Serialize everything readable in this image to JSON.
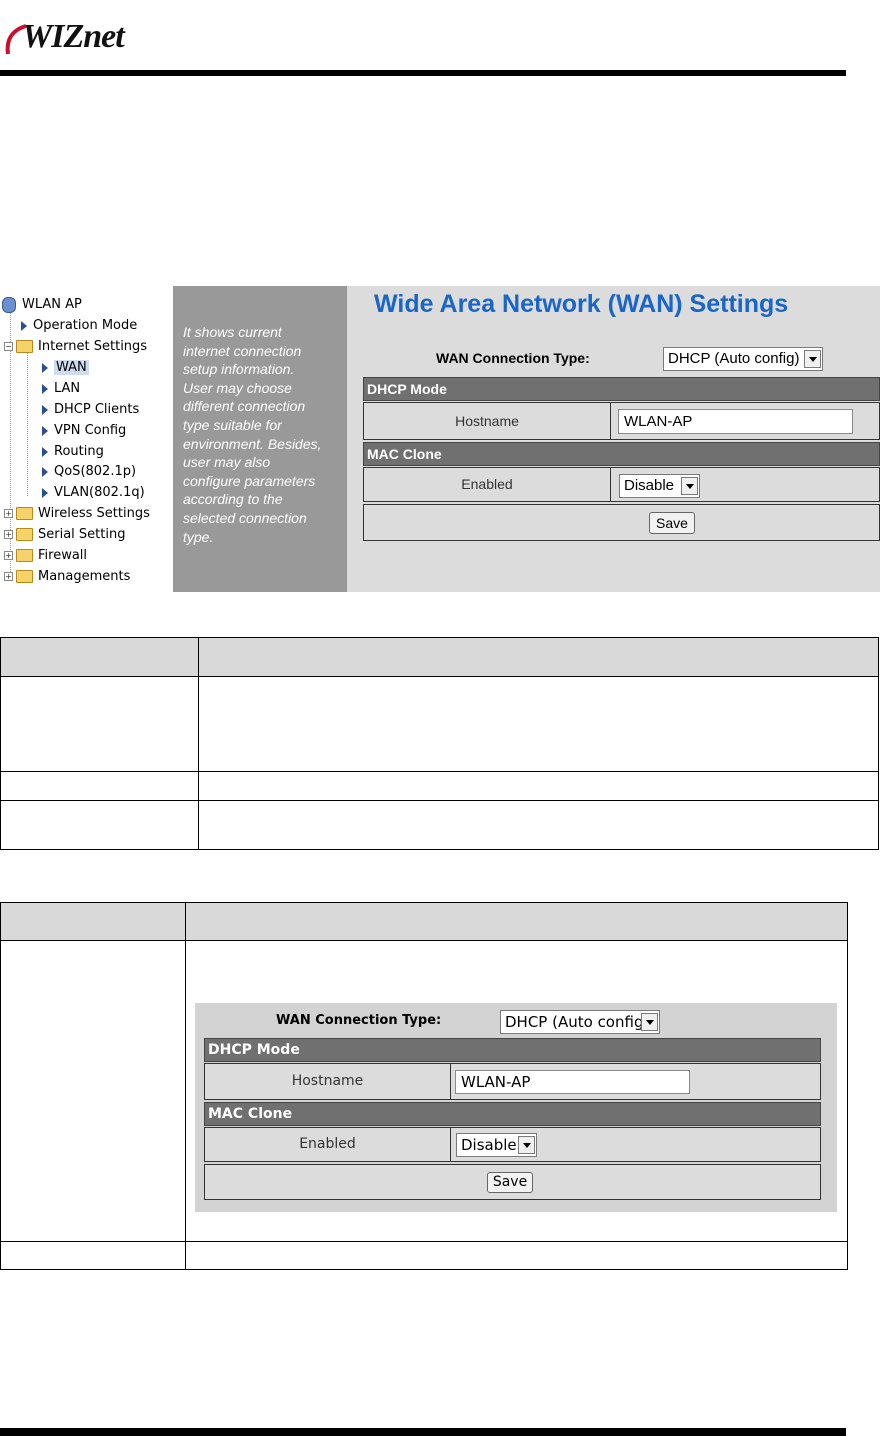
{
  "logo": {
    "text": "WIZnet"
  },
  "tree": {
    "root": "WLAN AP",
    "items": [
      {
        "label": "Operation Mode"
      },
      {
        "label": "Internet Settings"
      },
      {
        "label": "WAN"
      },
      {
        "label": "LAN"
      },
      {
        "label": "DHCP Clients"
      },
      {
        "label": "VPN Config"
      },
      {
        "label": "Routing"
      },
      {
        "label": "QoS(802.1p)"
      },
      {
        "label": "VLAN(802.1q)"
      },
      {
        "label": "Wireless Settings"
      },
      {
        "label": "Serial Setting"
      },
      {
        "label": "Firewall"
      },
      {
        "label": "Managements"
      }
    ]
  },
  "help": {
    "lines": [
      "It shows current",
      "internet connection",
      "setup information.",
      "User may choose",
      "different connection",
      "type suitable for",
      "environment. Besides,",
      "user may also",
      "configure parameters",
      "according to the",
      "selected connection",
      "type."
    ]
  },
  "wan": {
    "title": "Wide Area Network (WAN) Settings",
    "connection_type_label": "WAN Connection Type:",
    "connection_type_value": "DHCP (Auto config)",
    "dhcp_section": "DHCP Mode",
    "hostname_label": "Hostname",
    "hostname_value": "WLAN-AP",
    "mac_section": "MAC Clone",
    "enabled_label": "Enabled",
    "enabled_value": "Disable",
    "save_label": "Save"
  }
}
